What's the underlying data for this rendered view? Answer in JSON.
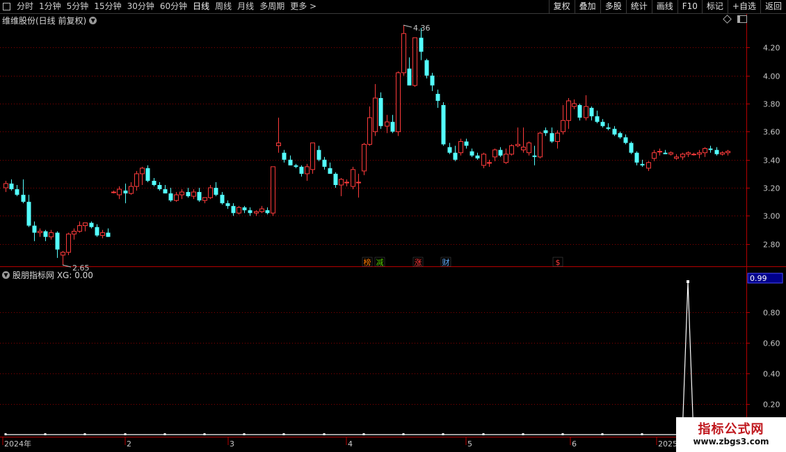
{
  "toolbar": {
    "periods": [
      "分时",
      "1分钟",
      "5分钟",
      "15分钟",
      "30分钟",
      "60分钟",
      "日线",
      "周线",
      "月线",
      "多周期",
      "更多 >"
    ],
    "active_period": "日线",
    "actions": [
      "复权",
      "叠加",
      "多股",
      "统计",
      "画线",
      "F10",
      "标记",
      "+自选",
      "返回"
    ]
  },
  "main_panel": {
    "title": "维维股份(日线 前复权)",
    "high_label": "4.36",
    "low_label": "2.65",
    "events": [
      {
        "label": "榜",
        "color": "#ff7a00"
      },
      {
        "label": "减",
        "color": "#55c800"
      },
      {
        "label": "涨",
        "color": "#ff3b3b"
      },
      {
        "label": "财",
        "color": "#66b0ff"
      },
      {
        "label": "$",
        "color": "#ff3b3b"
      }
    ]
  },
  "sub_panel": {
    "title": "股朋指标网 XG: 0.00",
    "current_value_label": "0.99"
  },
  "time_axis": {
    "labels": [
      "2024年",
      "2",
      "3",
      "4",
      "5",
      "6",
      "2025"
    ]
  },
  "watermark": {
    "title": "指标公式网",
    "url": "www.zbgs3.com"
  },
  "colors": {
    "up": "#ff3b3b",
    "down": "#54ffff",
    "axis": "#b40000",
    "grid": "#8a0000",
    "axis_text": "#c8c8c8",
    "indicator": "#ffffff"
  },
  "chart_data": [
    {
      "type": "candlestick",
      "title": "维维股份(日线 前复权)",
      "y_ticks": [
        2.8,
        3.0,
        3.2,
        3.4,
        3.6,
        3.8,
        4.0,
        4.2
      ],
      "ylim": [
        2.64,
        4.44
      ],
      "x_labels": [
        "2024年",
        "2",
        "3",
        "4",
        "5",
        "6",
        "2025"
      ],
      "highest": 4.36,
      "lowest": 2.65,
      "ohlc": [
        [
          3.2,
          3.25,
          3.17,
          3.23
        ],
        [
          3.23,
          3.26,
          3.18,
          3.19
        ],
        [
          3.19,
          3.22,
          3.14,
          3.15
        ],
        [
          3.15,
          3.26,
          3.09,
          3.1
        ],
        [
          3.1,
          3.15,
          2.92,
          2.93
        ],
        [
          2.93,
          2.96,
          2.82,
          2.88
        ],
        [
          2.88,
          2.91,
          2.85,
          2.89
        ],
        [
          2.89,
          2.9,
          2.82,
          2.85
        ],
        [
          2.85,
          2.9,
          2.83,
          2.88
        ],
        [
          2.88,
          2.89,
          2.7,
          2.76
        ],
        [
          2.72,
          2.75,
          2.65,
          2.74
        ],
        [
          2.74,
          2.88,
          2.72,
          2.87
        ],
        [
          2.87,
          2.91,
          2.83,
          2.89
        ],
        [
          2.89,
          2.96,
          2.88,
          2.93
        ],
        [
          2.93,
          2.95,
          2.89,
          2.95
        ],
        [
          2.95,
          2.96,
          2.91,
          2.92
        ],
        [
          2.92,
          2.94,
          2.85,
          2.86
        ],
        [
          2.86,
          2.9,
          2.84,
          2.88
        ],
        [
          2.88,
          2.91,
          2.85,
          2.85
        ],
        [
          3.17,
          3.18,
          3.16,
          3.17
        ],
        [
          3.15,
          3.21,
          3.12,
          3.19
        ],
        [
          3.18,
          3.23,
          3.09,
          3.16
        ],
        [
          3.16,
          3.24,
          3.15,
          3.21
        ],
        [
          3.21,
          3.32,
          3.18,
          3.3
        ],
        [
          3.3,
          3.35,
          3.22,
          3.34
        ],
        [
          3.34,
          3.36,
          3.24,
          3.25
        ],
        [
          3.25,
          3.27,
          3.21,
          3.22
        ],
        [
          3.22,
          3.24,
          3.18,
          3.19
        ],
        [
          3.19,
          3.22,
          3.16,
          3.16
        ],
        [
          3.16,
          3.2,
          3.1,
          3.11
        ],
        [
          3.11,
          3.17,
          3.1,
          3.15
        ],
        [
          3.15,
          3.19,
          3.12,
          3.17
        ],
        [
          3.17,
          3.2,
          3.13,
          3.14
        ],
        [
          3.14,
          3.19,
          3.12,
          3.17
        ],
        [
          3.17,
          3.2,
          3.1,
          3.11
        ],
        [
          3.11,
          3.13,
          3.09,
          3.13
        ],
        [
          3.13,
          3.22,
          3.12,
          3.2
        ],
        [
          3.2,
          3.24,
          3.14,
          3.15
        ],
        [
          3.15,
          3.17,
          3.08,
          3.09
        ],
        [
          3.09,
          3.11,
          3.05,
          3.07
        ],
        [
          3.07,
          3.09,
          3.0,
          3.02
        ],
        [
          3.02,
          3.07,
          3.01,
          3.06
        ],
        [
          3.06,
          3.07,
          3.02,
          3.04
        ],
        [
          3.04,
          3.06,
          3.0,
          3.02
        ],
        [
          3.02,
          3.04,
          3.0,
          3.03
        ],
        [
          3.03,
          3.07,
          3.02,
          3.05
        ],
        [
          3.04,
          3.06,
          3.01,
          3.02
        ],
        [
          3.02,
          3.35,
          3.0,
          3.35
        ],
        [
          3.5,
          3.7,
          3.45,
          3.52
        ],
        [
          3.45,
          3.47,
          3.38,
          3.4
        ],
        [
          3.4,
          3.43,
          3.36,
          3.36
        ],
        [
          3.36,
          3.37,
          3.34,
          3.35
        ],
        [
          3.35,
          3.36,
          3.28,
          3.3
        ],
        [
          3.3,
          3.37,
          3.25,
          3.35
        ],
        [
          3.33,
          3.52,
          3.3,
          3.52
        ],
        [
          3.47,
          3.5,
          3.39,
          3.4
        ],
        [
          3.4,
          3.42,
          3.33,
          3.35
        ],
        [
          3.34,
          3.38,
          3.3,
          3.3
        ],
        [
          3.3,
          3.31,
          3.2,
          3.22
        ],
        [
          3.22,
          3.27,
          3.14,
          3.26
        ],
        [
          3.24,
          3.26,
          3.21,
          3.24
        ],
        [
          3.21,
          3.35,
          3.19,
          3.33
        ],
        [
          3.24,
          3.3,
          3.13,
          3.24
        ],
        [
          3.32,
          3.52,
          3.29,
          3.51
        ],
        [
          3.51,
          3.78,
          3.5,
          3.7
        ],
        [
          3.6,
          3.94,
          3.57,
          3.84
        ],
        [
          3.84,
          3.88,
          3.62,
          3.64
        ],
        [
          3.64,
          3.72,
          3.59,
          3.67
        ],
        [
          3.67,
          3.72,
          3.59,
          3.6
        ],
        [
          3.6,
          4.03,
          3.57,
          4.02
        ],
        [
          4.02,
          4.36,
          4.0,
          4.3
        ],
        [
          4.05,
          4.13,
          3.93,
          3.93
        ],
        [
          3.93,
          4.25,
          3.92,
          4.27
        ],
        [
          4.27,
          4.34,
          4.11,
          4.17
        ],
        [
          4.11,
          4.12,
          3.98,
          4.0
        ],
        [
          4.0,
          4.02,
          3.89,
          3.93
        ],
        [
          3.87,
          3.9,
          3.77,
          3.82
        ],
        [
          3.79,
          3.81,
          3.5,
          3.51
        ],
        [
          3.49,
          3.52,
          3.44,
          3.45
        ],
        [
          3.45,
          3.5,
          3.39,
          3.4
        ],
        [
          3.45,
          3.55,
          3.43,
          3.53
        ],
        [
          3.53,
          3.55,
          3.48,
          3.5
        ],
        [
          3.46,
          3.48,
          3.42,
          3.43
        ],
        [
          3.43,
          3.45,
          3.4,
          3.41
        ],
        [
          3.36,
          3.45,
          3.34,
          3.44
        ],
        [
          3.38,
          3.4,
          3.35,
          3.38
        ],
        [
          3.42,
          3.48,
          3.39,
          3.47
        ],
        [
          3.47,
          3.49,
          3.42,
          3.43
        ],
        [
          3.38,
          3.48,
          3.37,
          3.44
        ],
        [
          3.44,
          3.51,
          3.43,
          3.5
        ],
        [
          3.5,
          3.63,
          3.49,
          3.51
        ],
        [
          3.47,
          3.63,
          3.45,
          3.49
        ],
        [
          3.45,
          3.53,
          3.43,
          3.52
        ],
        [
          3.43,
          3.5,
          3.36,
          3.42
        ],
        [
          3.42,
          3.6,
          3.41,
          3.59
        ],
        [
          3.61,
          3.63,
          3.57,
          3.59
        ],
        [
          3.59,
          3.63,
          3.52,
          3.53
        ],
        [
          3.53,
          3.61,
          3.48,
          3.59
        ],
        [
          3.6,
          3.79,
          3.58,
          3.68
        ],
        [
          3.68,
          3.84,
          3.62,
          3.82
        ],
        [
          3.78,
          3.83,
          3.76,
          3.8
        ],
        [
          3.79,
          3.8,
          3.68,
          3.7
        ],
        [
          3.7,
          3.86,
          3.68,
          3.78
        ],
        [
          3.77,
          3.78,
          3.68,
          3.71
        ],
        [
          3.71,
          3.75,
          3.66,
          3.67
        ],
        [
          3.67,
          3.69,
          3.63,
          3.64
        ],
        [
          3.63,
          3.66,
          3.61,
          3.62
        ],
        [
          3.62,
          3.64,
          3.57,
          3.58
        ],
        [
          3.59,
          3.6,
          3.55,
          3.56
        ],
        [
          3.56,
          3.58,
          3.51,
          3.52
        ],
        [
          3.52,
          3.53,
          3.44,
          3.45
        ],
        [
          3.45,
          3.46,
          3.36,
          3.38
        ],
        [
          3.37,
          3.4,
          3.35,
          3.36
        ],
        [
          3.34,
          3.39,
          3.32,
          3.38
        ],
        [
          3.41,
          3.47,
          3.39,
          3.45
        ],
        [
          3.46,
          3.48,
          3.43,
          3.46
        ],
        [
          3.45,
          3.47,
          3.44,
          3.44
        ],
        [
          3.44,
          3.46,
          3.43,
          3.45
        ],
        [
          3.41,
          3.44,
          3.4,
          3.42
        ],
        [
          3.42,
          3.45,
          3.4,
          3.44
        ],
        [
          3.44,
          3.46,
          3.42,
          3.45
        ],
        [
          3.44,
          3.45,
          3.43,
          3.44
        ],
        [
          3.44,
          3.47,
          3.41,
          3.45
        ],
        [
          3.45,
          3.49,
          3.42,
          3.48
        ],
        [
          3.48,
          3.5,
          3.45,
          3.47
        ],
        [
          3.47,
          3.49,
          3.43,
          3.44
        ],
        [
          3.44,
          3.46,
          3.43,
          3.45
        ],
        [
          3.45,
          3.47,
          3.43,
          3.46
        ]
      ]
    },
    {
      "type": "line",
      "title": "股朋指标网 XG",
      "y_ticks": [
        0.2,
        0.4,
        0.6,
        0.8
      ],
      "ylim": [
        0,
        1.0
      ],
      "current_value": 0.99,
      "spike_index": 120,
      "spike_value": 1.0,
      "baseline": 0.0
    }
  ]
}
